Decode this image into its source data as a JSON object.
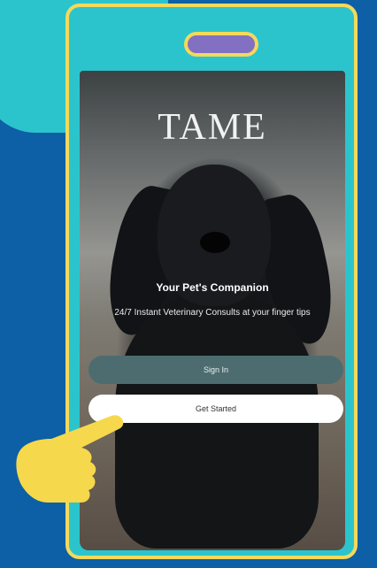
{
  "app": {
    "logo": "TAME",
    "headline": "Your Pet's Companion",
    "subline": "24/7 Instant Veterinary Consults at your finger tips"
  },
  "buttons": {
    "sign_in": "Sign In",
    "get_started": "Get Started"
  },
  "colors": {
    "page_background": "#0d5fa6",
    "phone_frame": "#2bc4cd",
    "outline": "#f4d95a",
    "notch": "#8270c2",
    "sign_in_button": "#4d6c6f",
    "get_started_button": "#ffffff",
    "hand": "#f6d84c"
  },
  "icons": {
    "pointer": "pointing-hand-icon",
    "hero": "dog-photo"
  }
}
